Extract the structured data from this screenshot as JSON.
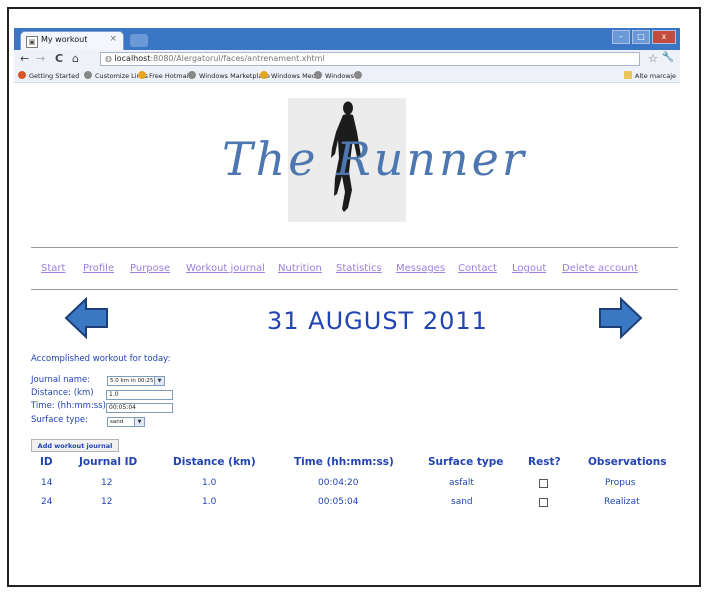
{
  "browser": {
    "tab_title": "My workout",
    "tab_close": "×",
    "win_min": "–",
    "win_max": "□",
    "win_close": "x",
    "nav_back": "←",
    "nav_forward": "→",
    "nav_reload": "C",
    "nav_home": "⌂",
    "address_host": "localhost",
    "address_path": ":8080/Alergatorul/faces/antrenament.xhtml",
    "star": "☆",
    "wrench": "🔧",
    "bookmarks": [
      {
        "label": "Getting Started",
        "icon": "fire-icon"
      },
      {
        "label": "Customize Links",
        "icon": "globe-icon"
      },
      {
        "label": "Free Hotmail",
        "icon": "msn-icon"
      },
      {
        "label": "Windows Marketplace",
        "icon": "globe-icon"
      },
      {
        "label": "Windows Media",
        "icon": "msn-icon"
      },
      {
        "label": "Windows",
        "icon": "globe-icon"
      },
      {
        "label": "",
        "icon": "globe-icon"
      }
    ],
    "other_bookmarks": "Alte marcaje"
  },
  "header": {
    "title": "The Runner"
  },
  "nav": {
    "items": [
      "Start",
      "Profile",
      "Purpose",
      "Workout journal",
      "Nutrition",
      "Statistics",
      "Messages",
      "Contact",
      "Logout",
      "Delete account"
    ]
  },
  "date": "31 AUGUST 2011",
  "accomplished_label": "Accomplished workout for today:",
  "form": {
    "journal_label": "Journal name:",
    "journal_value": "5.0 km in 00:25:00",
    "distance_label": "Distance: (km)",
    "distance_value": "1.0",
    "time_label": "Time: (hh:mm:ss)",
    "time_value": "00:05:04",
    "surface_label": "Surface type:",
    "surface_value": "sand"
  },
  "add_button": "Add workout journal",
  "table": {
    "headers": [
      "ID",
      "Journal ID",
      "Distance (km)",
      "Time (hh:mm:ss)",
      "Surface type",
      "Rest?",
      "Observations"
    ],
    "rows": [
      [
        "14",
        "12",
        "1.0",
        "00:04:20",
        "asfalt",
        "",
        "Propus"
      ],
      [
        "24",
        "12",
        "1.0",
        "00:05:04",
        "sand",
        "",
        "Realizat"
      ]
    ]
  },
  "colors": {
    "link": "#9c7fe0",
    "text_blue": "#2244b3",
    "title_blue": "#4d77b0",
    "arrow_blue": "#3a78c3"
  }
}
